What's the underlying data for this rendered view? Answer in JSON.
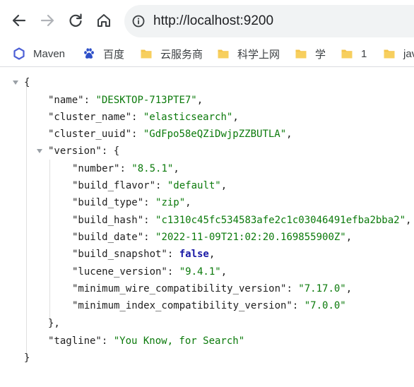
{
  "browser": {
    "url": "http://localhost:9200",
    "bookmarks": [
      {
        "label": "Maven",
        "icon": "maven-hexagon-icon"
      },
      {
        "label": "百度",
        "icon": "baidu-paw-icon"
      },
      {
        "label": "云服务商",
        "icon": "folder-icon"
      },
      {
        "label": "科学上网",
        "icon": "folder-icon"
      },
      {
        "label": "学",
        "icon": "folder-icon"
      },
      {
        "label": "1",
        "icon": "folder-icon"
      },
      {
        "label": "jav",
        "icon": "folder-icon"
      }
    ]
  },
  "json": {
    "open_brace": "{",
    "close_brace": "}",
    "rows": [
      {
        "key": "\"name\"",
        "value": "\"DESKTOP-713PTE7\"",
        "trail": ","
      },
      {
        "key": "\"cluster_name\"",
        "value": "\"elasticsearch\"",
        "trail": ","
      },
      {
        "key": "\"cluster_uuid\"",
        "value": "\"GdFpo58eQZiDwjpZZBUTLA\"",
        "trail": ","
      },
      {
        "key": "\"version\"",
        "value": "{",
        "trail": ""
      },
      {
        "key": "\"number\"",
        "value": "\"8.5.1\"",
        "trail": ","
      },
      {
        "key": "\"build_flavor\"",
        "value": "\"default\"",
        "trail": ","
      },
      {
        "key": "\"build_type\"",
        "value": "\"zip\"",
        "trail": ","
      },
      {
        "key": "\"build_hash\"",
        "value": "\"c1310c45fc534583afe2c1c03046491efba2bba2\"",
        "trail": ","
      },
      {
        "key": "\"build_date\"",
        "value": "\"2022-11-09T21:02:20.169855900Z\"",
        "trail": ","
      },
      {
        "key": "\"build_snapshot\"",
        "value": "false",
        "trail": ","
      },
      {
        "key": "\"lucene_version\"",
        "value": "\"9.4.1\"",
        "trail": ","
      },
      {
        "key": "\"minimum_wire_compatibility_version\"",
        "value": "\"7.17.0\"",
        "trail": ","
      },
      {
        "key": "\"minimum_index_compatibility_version\"",
        "value": "\"7.0.0\"",
        "trail": ""
      },
      {
        "key": "",
        "value": "},",
        "trail": ""
      },
      {
        "key": "\"tagline\"",
        "value": "\"You Know, for Search\"",
        "trail": ""
      }
    ],
    "colors": {
      "string": "#0b7a0b",
      "boolean": "#1a1aa6",
      "key": "#1f1f1f"
    }
  }
}
